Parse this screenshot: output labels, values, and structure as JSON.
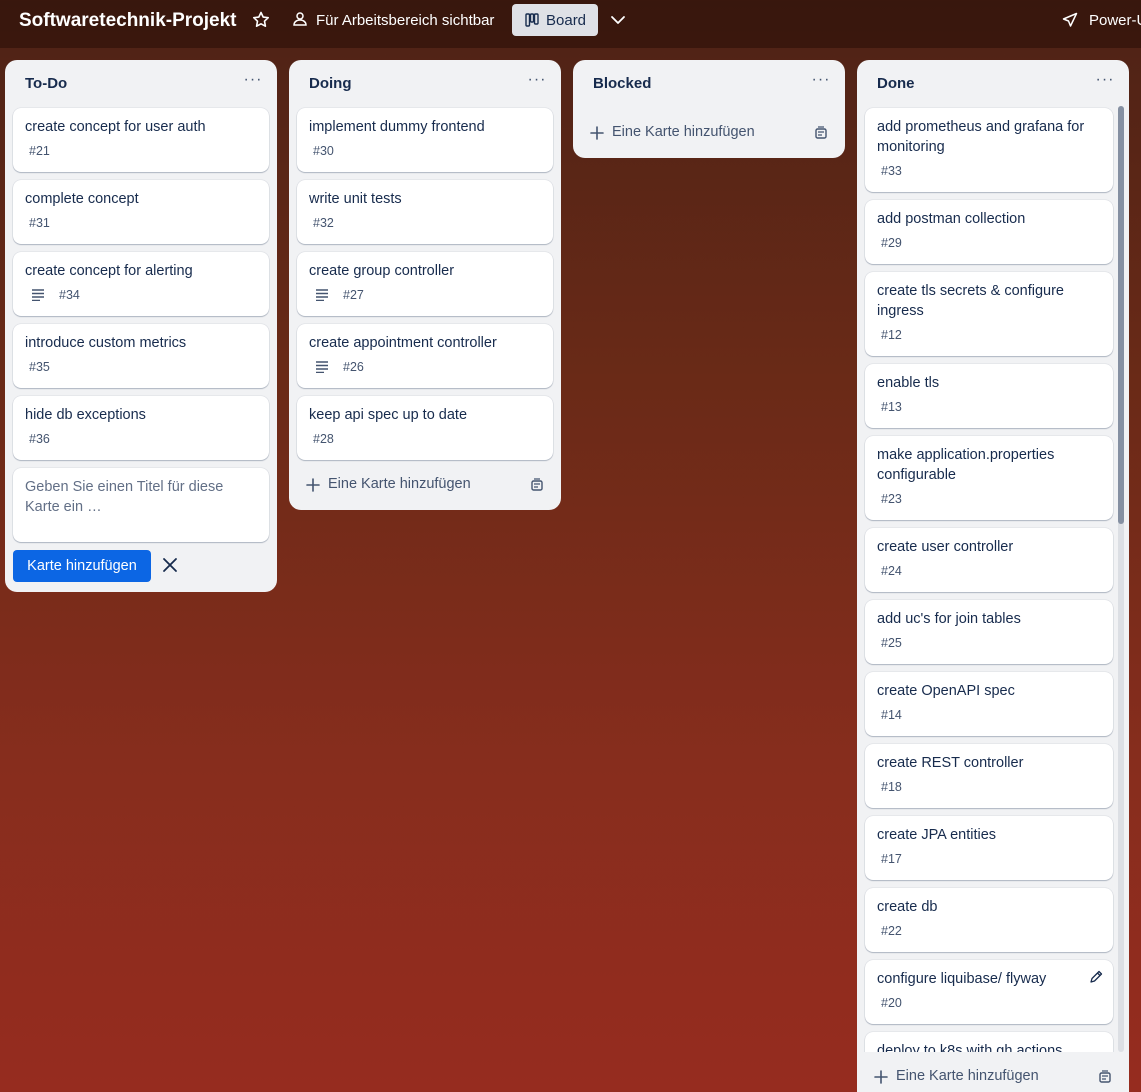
{
  "header": {
    "board_title": "Softwaretechnik-Projekt",
    "visibility_label": "Für Arbeitsbereich sichtbar",
    "view_button_label": "Board",
    "power_ups_label": "Power-U"
  },
  "lists": {
    "todo": {
      "title": "To-Do",
      "cards": [
        {
          "title": "create concept for user auth",
          "number": "#21"
        },
        {
          "title": "complete concept",
          "number": "#31"
        },
        {
          "title": "create concept for alerting",
          "number": "#34",
          "has_description": true
        },
        {
          "title": "introduce custom metrics",
          "number": "#35"
        },
        {
          "title": "hide db exceptions",
          "number": "#36"
        }
      ],
      "composer": {
        "placeholder": "Geben Sie einen Titel für diese Karte ein …",
        "submit_label": "Karte hinzufügen"
      }
    },
    "doing": {
      "title": "Doing",
      "cards": [
        {
          "title": "implement dummy frontend",
          "number": "#30"
        },
        {
          "title": "write unit tests",
          "number": "#32"
        },
        {
          "title": "create group controller",
          "number": "#27",
          "has_description": true
        },
        {
          "title": "create appointment controller",
          "number": "#26",
          "has_description": true
        },
        {
          "title": "keep api spec up to date",
          "number": "#28"
        }
      ],
      "add_card_label": "Eine Karte hinzufügen"
    },
    "blocked": {
      "title": "Blocked",
      "add_card_label": "Eine Karte hinzufügen"
    },
    "done": {
      "title": "Done",
      "cards": [
        {
          "title": "add prometheus and grafana for monitoring",
          "number": "#33"
        },
        {
          "title": "add postman collection",
          "number": "#29"
        },
        {
          "title": "create tls secrets & configure ingress",
          "number": "#12"
        },
        {
          "title": "enable tls",
          "number": "#13"
        },
        {
          "title": "make application.properties configurable",
          "number": "#23"
        },
        {
          "title": "create user controller",
          "number": "#24"
        },
        {
          "title": "add uc's for join tables",
          "number": "#25"
        },
        {
          "title": "create OpenAPI spec",
          "number": "#14"
        },
        {
          "title": "create REST controller",
          "number": "#18"
        },
        {
          "title": "create JPA entities",
          "number": "#17"
        },
        {
          "title": "create db",
          "number": "#22"
        },
        {
          "title": "configure liquibase/ flyway",
          "number": "#20"
        },
        {
          "title": "deploy to k8s with gh actions",
          "number": ""
        }
      ],
      "add_card_label": "Eine Karte hinzufügen"
    }
  },
  "icons": {
    "star": "star-icon",
    "visibility": "people-icon",
    "board": "board-icon",
    "chevron": "chevron-down-icon",
    "power_ups": "rocket-icon",
    "menu": "ellipsis-icon",
    "description": "description-icon",
    "add": "plus-icon",
    "template": "template-icon",
    "close": "close-icon",
    "edit": "pencil-icon"
  },
  "colors": {
    "accent": "#0c66e4",
    "list_bg": "#f1f2f4",
    "card_bg": "#ffffff"
  }
}
